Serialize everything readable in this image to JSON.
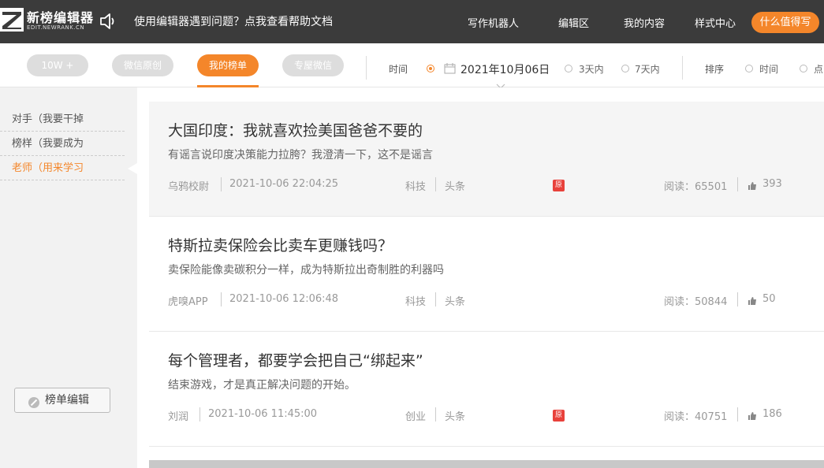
{
  "header": {
    "logo_name": "新榜编辑器",
    "logo_sub": "EDIT.NEWRANK.CN",
    "notice": "使用编辑器遇到问题？点我查看帮助文档",
    "nav": [
      "写作机器人",
      "编辑区",
      "我的内容",
      "样式中心"
    ],
    "cta": "什么值得写"
  },
  "filters": {
    "pills": [
      "10W +",
      "微信原创",
      "我的榜单",
      "专屋微信"
    ],
    "time_label": "时间",
    "date_value": "2021年10月06日",
    "range_options": [
      "3天内",
      "7天内"
    ],
    "sort_label": "排序",
    "sort_options": [
      "时间",
      "点"
    ]
  },
  "sidebar": {
    "items": [
      "对手（我要干掉",
      "榜样（我要成为",
      "老师（用来学习"
    ],
    "edit_button": "榜单编辑"
  },
  "articles": [
    {
      "title": "大国印度：我就喜欢捡美国爸爸不要的",
      "desc": "有谣言说印度决策能力拉胯？我澄清一下，这不是谣言",
      "author": "乌鸦校尉",
      "time": "2021-10-06 22:04:25",
      "category": "科技",
      "position": "头条",
      "badge": "原",
      "reads": "阅读：65501",
      "likes": "393"
    },
    {
      "title": "特斯拉卖保险会比卖车更赚钱吗？",
      "desc": "卖保险能像卖碳积分一样，成为特斯拉出奇制胜的利器吗",
      "author": "虎嗅APP",
      "time": "2021-10-06 12:06:48",
      "category": "科技",
      "position": "头条",
      "badge": "",
      "reads": "阅读：50844",
      "likes": "50"
    },
    {
      "title": "每个管理者，都要学会把自己“绑起来”",
      "desc": "结束游戏，才是真正解决问题的开始。",
      "author": "刘润",
      "time": "2021-10-06 11:45:00",
      "category": "创业",
      "position": "头条",
      "badge": "原",
      "reads": "阅读：40751",
      "likes": "186"
    }
  ],
  "colors": {
    "accent": "#f4862a",
    "header_bg": "#3b3b3b",
    "badge_red": "#e8413b"
  }
}
